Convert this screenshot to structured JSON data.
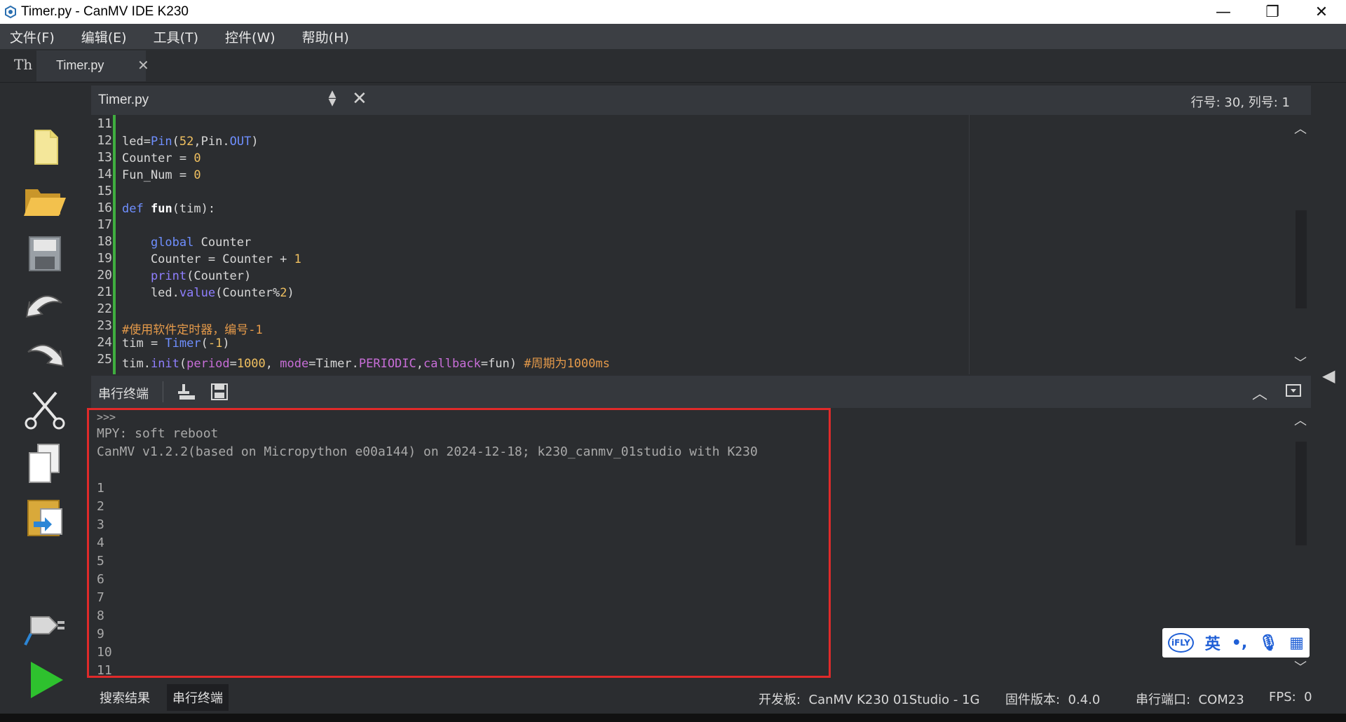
{
  "window": {
    "title": "Timer.py - CanMV IDE K230",
    "controls": [
      "—",
      "❐",
      "✕"
    ]
  },
  "menu": [
    "文件(F)",
    "编辑(E)",
    "工具(T)",
    "控件(W)",
    "帮助(H)"
  ],
  "tabs": {
    "icon": "Th",
    "active_tab": "Timer.py",
    "close": "✕"
  },
  "editor": {
    "file_name": "Timer.py",
    "position": "行号: 30, 列号: 1",
    "line_numbers": [
      "11",
      "12",
      "13",
      "14",
      "15",
      "16",
      "17",
      "18",
      "19",
      "20",
      "21",
      "22",
      "23",
      "24",
      "25"
    ],
    "scroll_up": "︿",
    "scroll_down": "﹀"
  },
  "terminal": {
    "label": "串行终端",
    "lines": [
      ">>>",
      "MPY: soft reboot",
      "CanMV v1.2.2(based on Micropython e00a144) on 2024-12-18; k230_canmv_01studio with K230",
      "",
      "1",
      "2",
      "3",
      "4",
      "5",
      "6",
      "7",
      "8",
      "9",
      "10",
      "11"
    ]
  },
  "ime": {
    "items": [
      "iFLY",
      "英",
      "•,",
      "🎙",
      "▦"
    ]
  },
  "status": {
    "tab_search": "搜索结果",
    "tab_serial": "串行终端",
    "board": "开发板:  CanMV K230 01Studio - 1G",
    "firmware": "固件版本:  0.4.0",
    "port": "串行端口:  COM23",
    "fps": "FPS:  0"
  }
}
